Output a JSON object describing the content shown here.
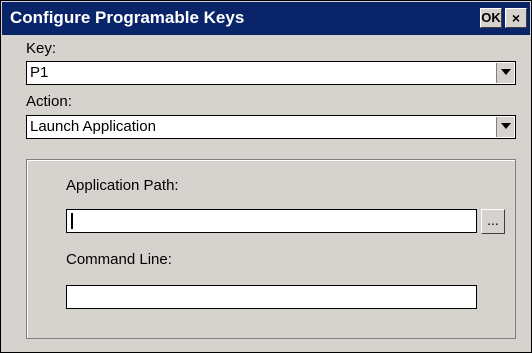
{
  "window": {
    "title": "Configure Programable Keys",
    "ok_label": "OK",
    "close_glyph": "×"
  },
  "key": {
    "label": "Key:",
    "selected": "P1"
  },
  "action": {
    "label": "Action:",
    "selected": "Launch Application"
  },
  "application_path": {
    "label": "Application Path:",
    "value": "",
    "browse_label": "..."
  },
  "command_line": {
    "label": "Command Line:",
    "value": ""
  },
  "icons": {
    "dropdown": "chevron-down-icon",
    "close": "close-icon"
  },
  "colors": {
    "titlebar": "#0a246a",
    "face": "#d6d3ce"
  }
}
